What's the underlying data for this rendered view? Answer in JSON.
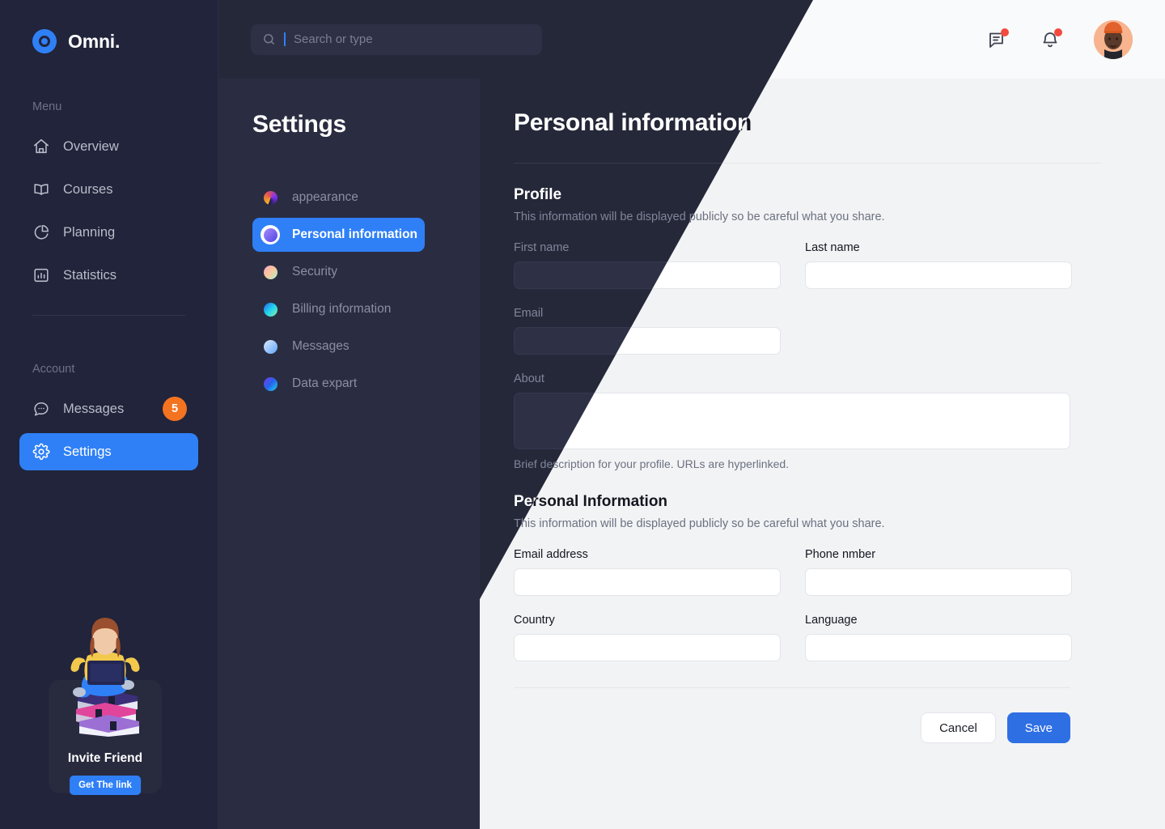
{
  "brand": {
    "name": "Omni.",
    "logo_icon": "target-circle-icon"
  },
  "search": {
    "placeholder": "Search or type",
    "icon": "search-icon"
  },
  "topbar": {
    "messages_icon": "message-square-icon",
    "notifications_icon": "bell-icon",
    "avatar": "user-avatar",
    "has_message_badge": true,
    "has_notification_badge": true
  },
  "sidebar": {
    "menu_label": "Menu",
    "account_label": "Account",
    "menu_items": [
      {
        "label": "Overview",
        "icon": "home-icon",
        "active": false
      },
      {
        "label": "Courses",
        "icon": "book-open-icon",
        "active": false
      },
      {
        "label": "Planning",
        "icon": "pie-chart-icon",
        "active": false
      },
      {
        "label": "Statistics",
        "icon": "bar-chart-icon",
        "active": false
      }
    ],
    "account_items": [
      {
        "label": "Messages",
        "icon": "chat-bubble-icon",
        "active": false,
        "badge": "5"
      },
      {
        "label": "Settings",
        "icon": "gear-icon",
        "active": true,
        "badge": ""
      }
    ],
    "invite": {
      "title": "Invite Friend",
      "button": "Get The link",
      "art": "person-reading-on-books-illustration"
    }
  },
  "settings_nav": {
    "title": "Settings",
    "items": [
      {
        "label": "appearance",
        "active": false,
        "c1": "#f0b429",
        "c2": "#7b2ff7"
      },
      {
        "label": "Personal information",
        "active": true,
        "c1": "#8b5cf6",
        "c2": "#4f46e5"
      },
      {
        "label": "Security",
        "active": false,
        "c1": "#f9a8d4",
        "c2": "#a5f3d0"
      },
      {
        "label": "Billing information",
        "active": false,
        "c1": "#22d3ee",
        "c2": "#16a34a"
      },
      {
        "label": "Messages",
        "active": false,
        "c1": "#bfdbfe",
        "c2": "#60a5fa"
      },
      {
        "label": "Data expart",
        "active": false,
        "c1": "#7c3aed",
        "c2": "#2563eb"
      }
    ]
  },
  "page": {
    "title": "Personal information",
    "profile": {
      "heading": "Profile",
      "subtext": "This information will be displayed publicly so be careful what you share.",
      "first_name_label": "First name",
      "first_name_value": "",
      "last_name_label": "Last name",
      "last_name_value": "",
      "email_label": "Email",
      "email_value": "",
      "about_label": "About",
      "about_value": "",
      "about_hint": "Brief description for your profile. URLs are hyperlinked."
    },
    "personal": {
      "heading": "Personal Information",
      "subtext": "This information will be displayed publicly so be careful what you share.",
      "email_label": "Email address",
      "email_value": "",
      "phone_label": "Phone nmber",
      "phone_value": "",
      "country_label": "Country",
      "country_value": "",
      "language_label": "Language",
      "language_value": ""
    },
    "actions": {
      "cancel": "Cancel",
      "save": "Save"
    }
  },
  "colors": {
    "accent_blue": "#2f80f7",
    "save_blue": "#2f6fe4",
    "badge_orange": "#f47321",
    "alert_red": "#f4493d",
    "dark_bg": "#252839",
    "dark_sidebar": "#21243a",
    "dark_panel": "#2a2d41",
    "light_bg": "#f2f3f5",
    "light_header": "#f9fafb"
  }
}
